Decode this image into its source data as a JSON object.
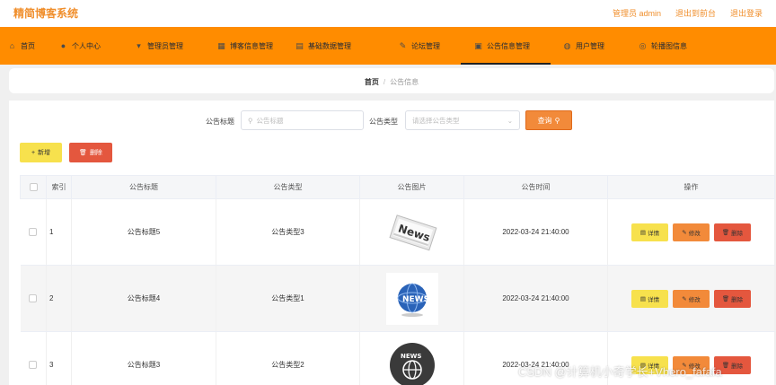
{
  "header": {
    "brand": "精简博客系统",
    "admin_label": "管理员 admin",
    "back_to_front": "退出到前台",
    "logout": "退出登录"
  },
  "nav": {
    "items": [
      {
        "label": "首页",
        "icon": "home-icon"
      },
      {
        "label": "个人中心",
        "icon": "user-icon"
      },
      {
        "label": "管理员管理",
        "icon": "admin-icon"
      },
      {
        "label": "博客信息管理",
        "icon": "grid-icon"
      },
      {
        "label": "基础数据管理",
        "icon": "data-icon"
      },
      {
        "label": "论坛管理",
        "icon": "forum-icon"
      },
      {
        "label": "公告信息管理",
        "icon": "notice-icon"
      },
      {
        "label": "用户管理",
        "icon": "users-icon"
      },
      {
        "label": "轮播图信息",
        "icon": "carousel-icon"
      }
    ],
    "active_index": 6
  },
  "breadcrumb": {
    "home": "首页",
    "separator": "/",
    "current": "公告信息"
  },
  "search": {
    "title_label": "公告标题",
    "title_placeholder": "公告标题",
    "type_label": "公告类型",
    "type_placeholder": "请选择公告类型",
    "query_button": "查询"
  },
  "actions": {
    "add": "新增",
    "delete": "删除"
  },
  "table": {
    "columns": [
      "索引",
      "公告标题",
      "公告类型",
      "公告图片",
      "公告时间",
      "操作"
    ],
    "rows": [
      {
        "index": "1",
        "title": "公告标题5",
        "type": "公告类型3",
        "image": "news-paper-image",
        "time": "2022-03-24 21:40:00"
      },
      {
        "index": "2",
        "title": "公告标题4",
        "type": "公告类型1",
        "image": "globe-news-image",
        "time": "2022-03-24 21:40:00"
      },
      {
        "index": "3",
        "title": "公告标题3",
        "type": "公告类型2",
        "image": "news-globe-circle-image",
        "time": "2022-03-24 21:40:00"
      }
    ],
    "row_actions": {
      "detail": "详情",
      "edit": "修改",
      "remove": "删除"
    }
  },
  "watermark": "CSDN @计算机小奇学长+Vhero_fafafa",
  "colors": {
    "accent": "#ff8c00",
    "brand_text": "#f08f2d",
    "yellow": "#f7e14d",
    "orange": "#f28a3a",
    "red": "#e4573e"
  }
}
